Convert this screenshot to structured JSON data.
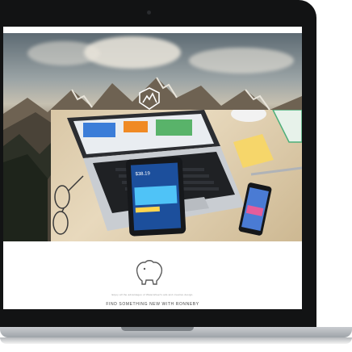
{
  "site": {
    "tagline": "Enjoy all the advantages of Waterwheel's ads and creative design.",
    "footer_link": "FIND SOMETHING NEW WITH RONNEBY"
  },
  "icons": {
    "brand_logo": "mountain-emblem-icon",
    "bear_logo": "bear-outline-icon",
    "camera": "camera-dot"
  },
  "phone_screen": {
    "price": "$38.19"
  },
  "colors": {
    "bezel": "#121314",
    "page_background": "#ffffff",
    "base": "#c9ccd0"
  }
}
